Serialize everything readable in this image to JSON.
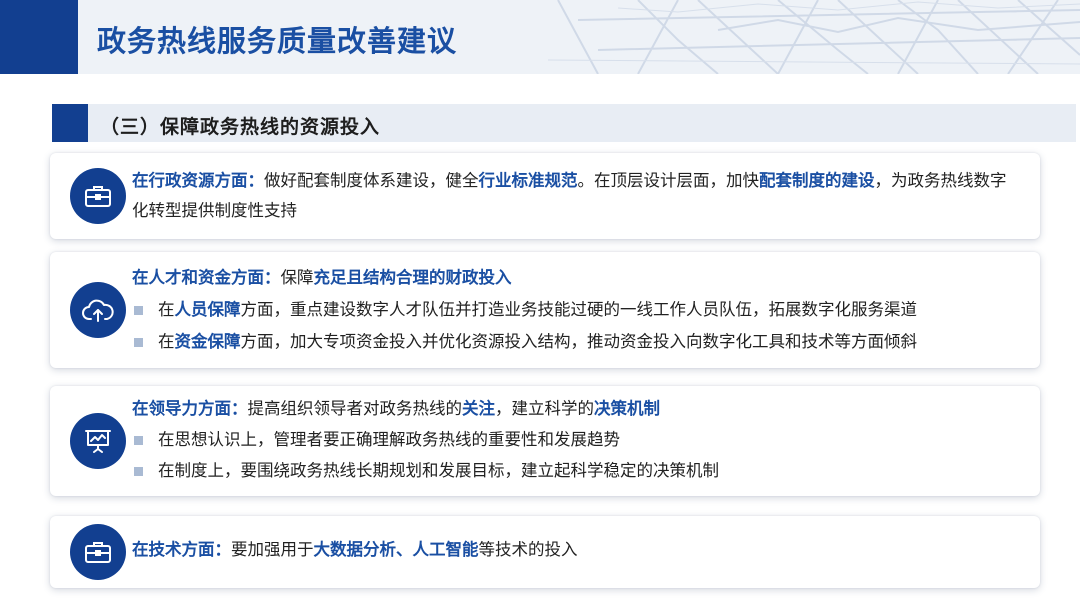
{
  "header": {
    "title": "政务热线服务质量改善建议"
  },
  "section": {
    "title": "（三）保障政务热线的资源投入"
  },
  "cards": [
    {
      "icon": "briefcase-icon",
      "lead": "在行政资源方面：",
      "text_1": "做好配套制度体系建设，健全",
      "hl_1": "行业标准规范",
      "text_2": "。在顶层设计层面，加快",
      "hl_2": "配套制度的建设",
      "text_3": "，为政务热线数字化转型提供制度性支持"
    },
    {
      "icon": "cloud-upload-icon",
      "lead": "在人才和资金方面：",
      "text_1": "保障",
      "hl_1": "充足且结构合理的财政投入",
      "bullets": [
        {
          "pre": "在",
          "hl": "人员保障",
          "post": "方面，重点建设数字人才队伍并打造业务技能过硬的一线工作人员队伍，拓展数字化服务渠道"
        },
        {
          "pre": "在",
          "hl": "资金保障",
          "post": "方面，加大专项资金投入并优化资源投入结构，推动资金投入向数字化工具和技术等方面倾斜"
        }
      ]
    },
    {
      "icon": "presentation-chart-icon",
      "lead": "在领导力方面：",
      "text_1": "提高组织领导者对政务热线的",
      "hl_1": "关注",
      "text_2": "，建立科学的",
      "hl_2": "决策机制",
      "bullets": [
        {
          "text": "在思想认识上，管理者要正确理解政务热线的重要性和发展趋势"
        },
        {
          "text": "在制度上，要围绕政务热线长期规划和发展目标，建立起科学稳定的决策机制"
        }
      ]
    },
    {
      "icon": "briefcase-icon",
      "lead": "在技术方面：",
      "text_1": "要加强用于",
      "hl_1": "大数据分析、人工智能",
      "text_2": "等技术的投入"
    }
  ],
  "colors": {
    "primary": "#123f90",
    "accent_text": "#1a4fa3",
    "section_bg": "#e8edf4",
    "bullet": "#a9bad3"
  }
}
